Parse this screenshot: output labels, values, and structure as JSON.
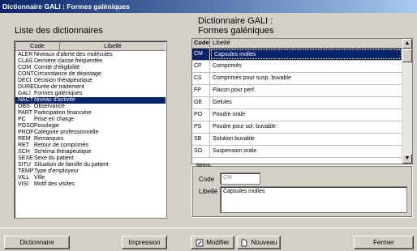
{
  "window": {
    "title": "Dictionnaire GALI : Formes galéniques"
  },
  "left": {
    "title": "Liste des dictionnaires",
    "col_code": "Code",
    "col_libelle": "Libellé",
    "selected_index": 7,
    "rows": [
      {
        "code": "ALER",
        "label": "Niveaux d'alerte des molécules"
      },
      {
        "code": "CLAS",
        "label": "Dernière classe fréquentée"
      },
      {
        "code": "COM",
        "label": "Comité d'éligibilité"
      },
      {
        "code": "CONT",
        "label": "Circonstance de dépistage"
      },
      {
        "code": "DECI",
        "label": "Décision thérapeutique"
      },
      {
        "code": "DURE",
        "label": "Durée de traitement"
      },
      {
        "code": "GALI",
        "label": "Formes galéniques"
      },
      {
        "code": "NACT",
        "label": "Niveau d'activité"
      },
      {
        "code": "OBS",
        "label": "Observance"
      },
      {
        "code": "PART",
        "label": "Participation financière"
      },
      {
        "code": "PC",
        "label": "Prise en charge"
      },
      {
        "code": "POSO",
        "label": "Posologie"
      },
      {
        "code": "PROF",
        "label": "Catégorie professionnelle"
      },
      {
        "code": "REM",
        "label": "Remarques"
      },
      {
        "code": "RET",
        "label": "Retour de comprimés"
      },
      {
        "code": "SCH",
        "label": "Schéma thérapeutique"
      },
      {
        "code": "SEXE",
        "label": "Sexe du patient"
      },
      {
        "code": "SITU",
        "label": "Situation de famille du patient"
      },
      {
        "code": "TEMP",
        "label": "Type d'employeur"
      },
      {
        "code": "VILL",
        "label": "Ville"
      },
      {
        "code": "VISI",
        "label": "Motif des visites"
      }
    ]
  },
  "right": {
    "title_line1": "Dictionnaire GALI :",
    "title_line2": "Formes galéniques",
    "col_code": "Code",
    "col_libelle": "Libellé",
    "rows": [
      {
        "code": "CM",
        "label": "Capsules molles"
      },
      {
        "code": "CP",
        "label": "Comprimés"
      },
      {
        "code": "CS",
        "label": "Comprimés pour susp. buvable"
      },
      {
        "code": "FP",
        "label": "Flacon pour perf."
      },
      {
        "code": "GE",
        "label": "Gelules"
      },
      {
        "code": "PO",
        "label": "Poudre orale"
      },
      {
        "code": "PS",
        "label": "Poudre pour sol. buvable"
      },
      {
        "code": "SB",
        "label": "Solution buvable"
      },
      {
        "code": "SO",
        "label": "Suspension orale"
      }
    ],
    "items": {
      "legend": "Items",
      "code_label": "Code",
      "code_value": "CM",
      "libelle_label": "Libellé",
      "libelle_value": "Capsules molles"
    }
  },
  "buttons": {
    "dictionnaire": "Dictionnaire",
    "impression": "Impression",
    "modifier": "Modifier",
    "nouveau": "Nouveau",
    "fermer": "Fermer"
  },
  "colors": {
    "selection": "#0a246a",
    "face": "#d4d0c8"
  }
}
